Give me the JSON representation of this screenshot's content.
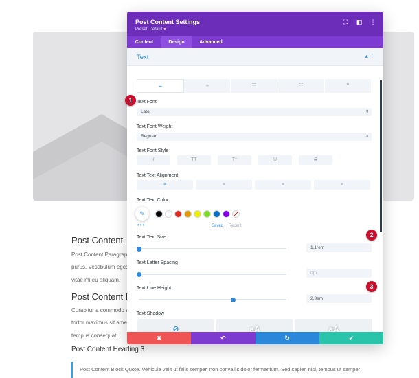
{
  "page": {
    "heading1": "Post Content",
    "para1": "Post Content Paragrap",
    "para1b": "purus. Vestibulum eges",
    "para1c": "vitae mi eu aliquam.",
    "heading2": "Post Content H",
    "para2": "Curabitur a commodo s",
    "para2b": "tortor maximus sit ame",
    "para2c": "tempus consequat.",
    "heading3": "Post Content Heading 3",
    "blockquote": "Post Content Block Quote. Vehicula velit ut felis semper, non convallis dolor fermentum. Sed sapien nisl, tempus ut semper"
  },
  "modal": {
    "title": "Post Content Settings",
    "preset": "Preset: Default ▾",
    "header_icons": [
      "expand-icon",
      "split-view-icon",
      "more-icon"
    ],
    "tabs": [
      {
        "label": "Content",
        "active": false
      },
      {
        "label": "Design",
        "active": true
      },
      {
        "label": "Advanced",
        "active": false
      }
    ],
    "section_title": "Text",
    "section_controls": "▴ ⋮",
    "subtabs": [
      {
        "icon": "align-text-icon",
        "glyph": "≡",
        "active": true
      },
      {
        "icon": "link-icon",
        "glyph": "⚭",
        "active": false
      },
      {
        "icon": "unordered-list-icon",
        "glyph": "☰",
        "active": false
      },
      {
        "icon": "ordered-list-icon",
        "glyph": "☷",
        "active": false
      },
      {
        "icon": "quote-icon",
        "glyph": "❞",
        "active": false
      }
    ],
    "text_font": {
      "label": "Text Font",
      "value": "Lato"
    },
    "font_weight": {
      "label": "Text Font Weight",
      "value": "Regular"
    },
    "font_style": {
      "label": "Text Font Style",
      "buttons": [
        {
          "name": "italic",
          "glyph": "I"
        },
        {
          "name": "uppercase",
          "glyph": "TT"
        },
        {
          "name": "capitalize",
          "glyph": "Tт"
        },
        {
          "name": "underline",
          "glyph": "U"
        },
        {
          "name": "strikethrough",
          "glyph": "S"
        }
      ]
    },
    "alignment": {
      "label": "Text Text Alignment",
      "buttons": [
        {
          "name": "left",
          "glyph": "≡",
          "active": true
        },
        {
          "name": "center",
          "glyph": "≡",
          "active": false
        },
        {
          "name": "right",
          "glyph": "≡",
          "active": false
        },
        {
          "name": "justify",
          "glyph": "≡",
          "active": false
        }
      ]
    },
    "text_color": {
      "label": "Text Text Color",
      "picker_icon": "eyedropper-icon",
      "more": "•••",
      "swatches": [
        "#000000",
        "#ffffff",
        "#e02b20",
        "#e09900",
        "#edf000",
        "#7cda24",
        "#0c71c3",
        "#8300e9"
      ],
      "saved_label": "Saved",
      "recent_label": "Recent"
    },
    "text_size": {
      "label": "Text Text Size",
      "value": "1.1rem",
      "slider": 0.0
    },
    "letter_spacing": {
      "label": "Text Letter Spacing",
      "value": "0px",
      "slider": 0.0
    },
    "line_height": {
      "label": "Text Line Height",
      "value": "2.3em",
      "slider": 0.64
    },
    "text_shadow": {
      "label": "Text Shadow",
      "options": [
        {
          "name": "none",
          "glyph": "⊘"
        },
        {
          "name": "preset-1",
          "glyph": "aA"
        },
        {
          "name": "preset-2",
          "glyph": "aA"
        }
      ]
    },
    "footer": [
      {
        "name": "cancel",
        "glyph": "✖",
        "color": "#ef5555"
      },
      {
        "name": "undo",
        "glyph": "↶",
        "color": "#7e3bd0"
      },
      {
        "name": "redo",
        "glyph": "↻",
        "color": "#2b87da"
      },
      {
        "name": "save",
        "glyph": "✔",
        "color": "#29c4a9"
      }
    ]
  },
  "badges": [
    "1",
    "2",
    "3"
  ],
  "colors": {
    "header": "#6c2eb9",
    "tabs": "#7d3bd1",
    "accent": "#2b87da",
    "badge": "#c8102e"
  }
}
